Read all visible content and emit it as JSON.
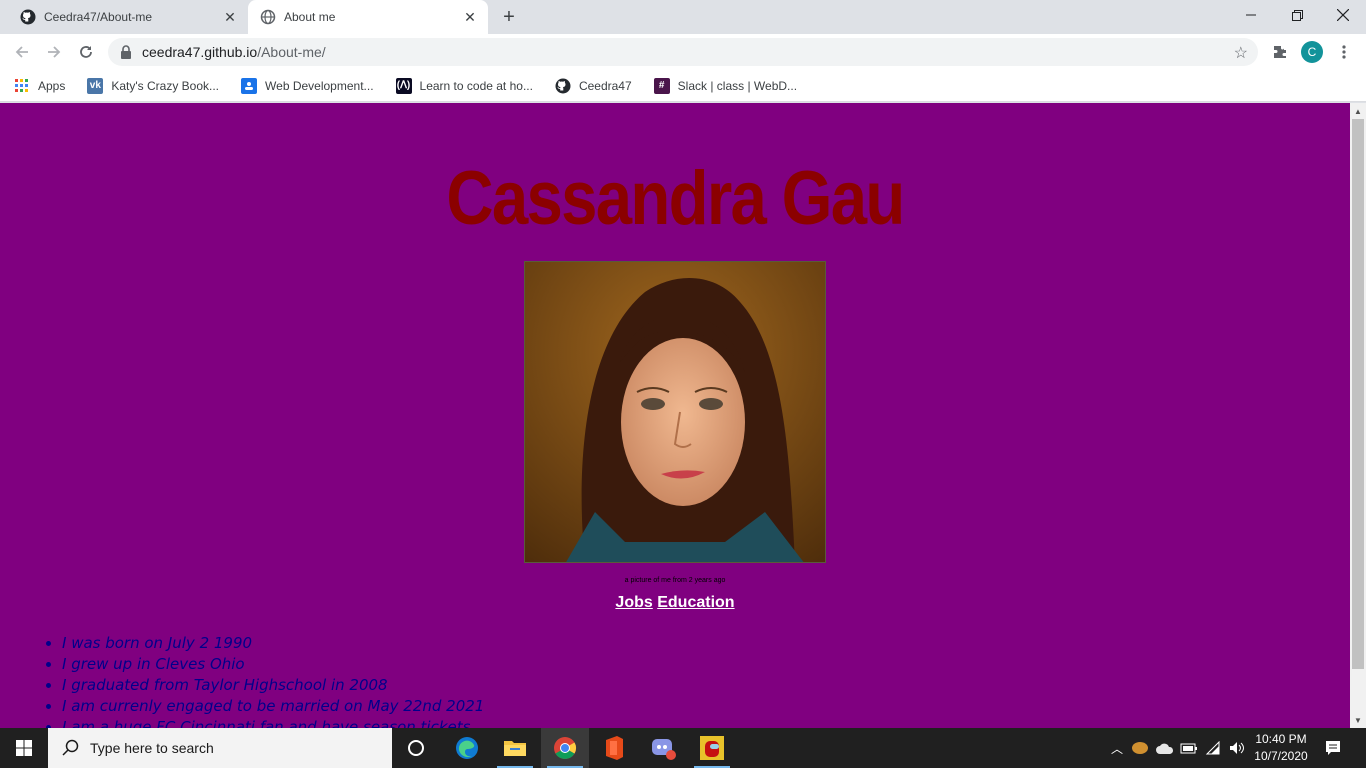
{
  "browser": {
    "tabs": [
      {
        "title": "Ceedra47/About-me",
        "icon": "github-icon"
      },
      {
        "title": "About me",
        "icon": "globe-icon"
      }
    ],
    "url_host": "ceedra47.github.io",
    "url_path": "/About-me/",
    "avatar_letter": "C",
    "bookmarks": [
      {
        "label": "Apps"
      },
      {
        "label": "Katy's Crazy Book..."
      },
      {
        "label": "Web Development..."
      },
      {
        "label": "Learn to code at ho..."
      },
      {
        "label": "Ceedra47"
      },
      {
        "label": "Slack | class | WebD..."
      }
    ]
  },
  "page": {
    "background": "#800080",
    "heading": "Cassandra Gau",
    "heading_color": "#8b0000",
    "photo_caption": "a picture of me from 2 years ago",
    "links": {
      "jobs": "Jobs",
      "education": "Education"
    },
    "facts": [
      "I was born on July 2 1990",
      "I grew up in Cleves Ohio",
      "I graduated from Taylor Highschool in 2008",
      "I am currenly engaged to be married on May 22nd 2021",
      "I am a huge FC Cincinnati fan and have season tickets"
    ]
  },
  "taskbar": {
    "search_placeholder": "Type here to search",
    "time": "10:40 PM",
    "date": "10/7/2020"
  }
}
